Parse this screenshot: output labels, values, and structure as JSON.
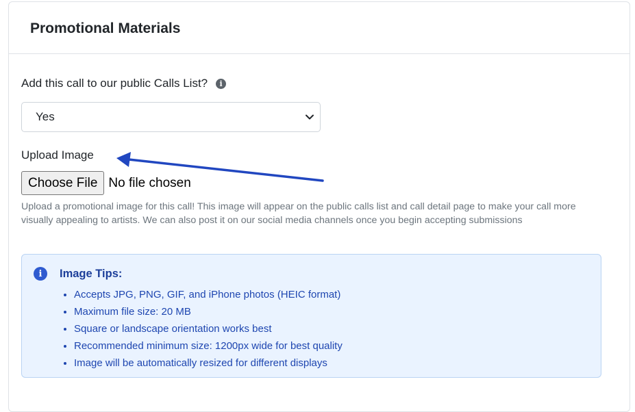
{
  "section": {
    "title": "Promotional Materials"
  },
  "public_list": {
    "label": "Add this call to our public Calls List?",
    "info_icon": "info-circle-icon",
    "selected": "Yes"
  },
  "upload": {
    "label": "Upload Image",
    "button_label": "Choose File",
    "status": "No file chosen",
    "help_text": "Upload a promotional image for this call! This image will appear on the public calls list and call detail page to make your call more visually appealing to artists. We can also post it on our social media channels once you begin accepting submissions"
  },
  "tips": {
    "icon": "info-circle-icon",
    "title": "Image Tips:",
    "items": [
      "Accepts JPG, PNG, GIF, and iPhone photos (HEIC format)",
      "Maximum file size: 20 MB",
      "Square or landscape orientation works best",
      "Recommended minimum size: 1200px wide for best quality",
      "Image will be automatically resized for different displays"
    ]
  },
  "colors": {
    "arrow": "#2147c0",
    "tips_background": "#eaf3ff",
    "tips_text": "#1e46b0"
  }
}
